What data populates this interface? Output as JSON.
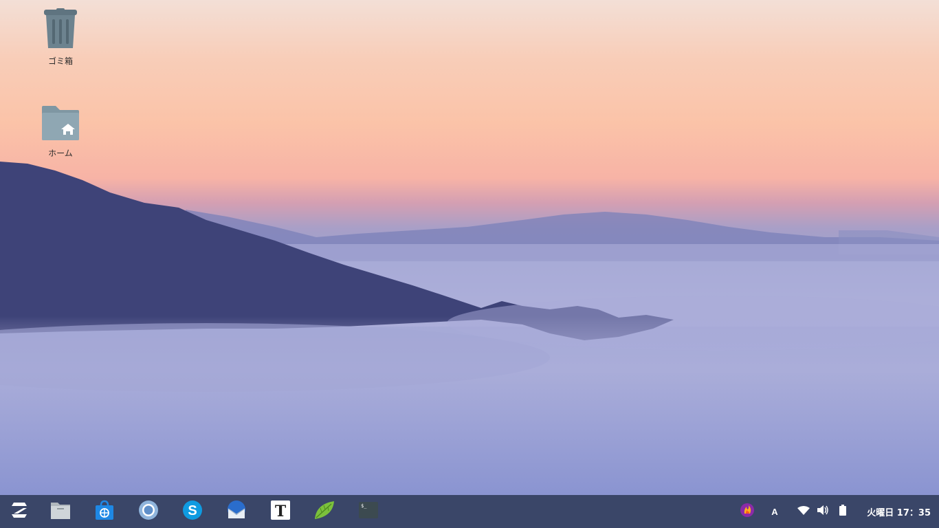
{
  "desktop": {
    "icons": [
      {
        "label": "ゴミ箱",
        "icon": "trash-icon"
      },
      {
        "label": "ホーム",
        "icon": "home-folder-icon"
      }
    ]
  },
  "taskbar": {
    "background": "#3a4668",
    "launchers": [
      {
        "name": "zorin-menu",
        "icon": "zorin-logo-icon"
      },
      {
        "name": "files",
        "icon": "files-icon"
      },
      {
        "name": "software",
        "icon": "software-store-icon"
      },
      {
        "name": "chromium",
        "icon": "chromium-icon"
      },
      {
        "name": "skype",
        "icon": "skype-icon"
      },
      {
        "name": "thunderbird",
        "icon": "thunderbird-icon"
      },
      {
        "name": "typora",
        "icon": "typora-icon"
      },
      {
        "name": "notes",
        "icon": "leaf-editor-icon"
      },
      {
        "name": "terminal",
        "icon": "terminal-icon"
      }
    ],
    "tray": {
      "app_indicator": "flame-icon",
      "ime_label": "A",
      "wifi": "wifi-icon",
      "volume": "volume-icon",
      "battery": "battery-icon"
    },
    "clock": "火曜日 17：35"
  }
}
